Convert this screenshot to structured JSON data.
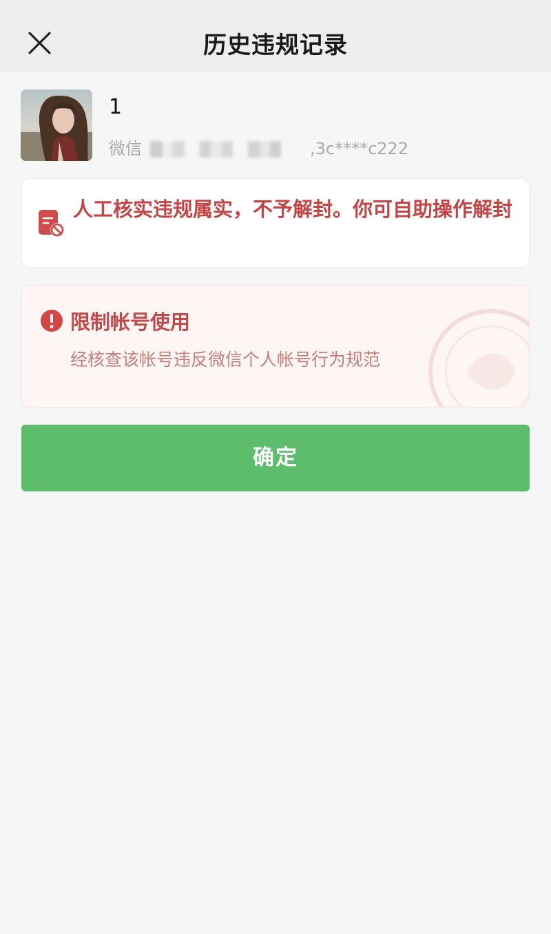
{
  "header": {
    "title": "历史违规记录",
    "close_icon": "close-icon"
  },
  "profile": {
    "name": "1",
    "id_prefix": "微信",
    "id_suffix": ",3c****c222"
  },
  "notice": {
    "icon": "restricted-document-icon",
    "text": "人工核实违规属实，不予解封。你可自助操作解封"
  },
  "restriction": {
    "icon": "exclamation-circle-icon",
    "title": "限制帐号使用",
    "description": "经核查该帐号违反微信个人帐号行为规范"
  },
  "actions": {
    "confirm_label": "确定"
  },
  "colors": {
    "accent_green": "#5dbd6d",
    "warning_red": "#c44545",
    "restriction_bg": "#fdf6f5"
  }
}
